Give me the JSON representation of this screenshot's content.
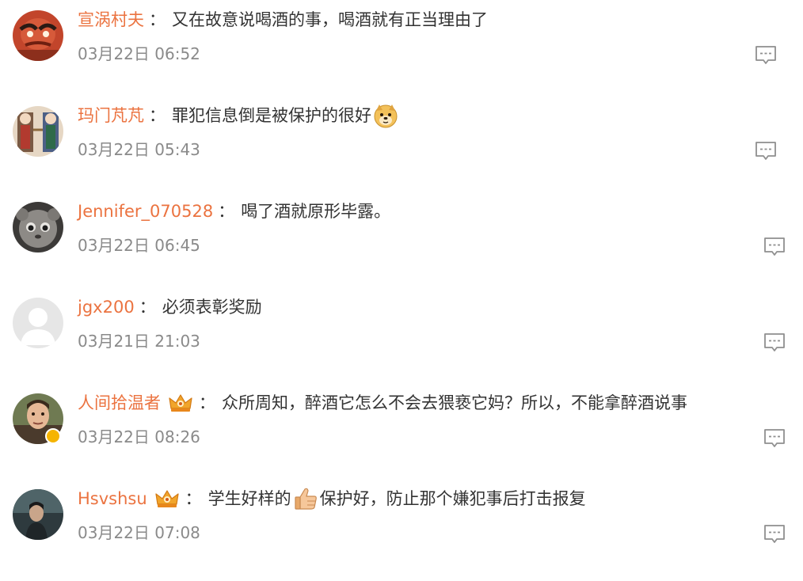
{
  "comments": [
    {
      "username": "宣涡村夫",
      "text": "又在故意说喝酒的事，喝酒就有正当理由了",
      "timestamp": "03月22日 06:52"
    },
    {
      "username": "玛门芃芃",
      "text": "罪犯信息倒是被保护的很好",
      "timestamp": "03月22日 05:43"
    },
    {
      "username": "Jennifer_070528",
      "text": "喝了酒就原形毕露。",
      "timestamp": "03月22日 06:45"
    },
    {
      "username": "jgx200",
      "text": "必须表彰奖励",
      "timestamp": "03月21日 21:03"
    },
    {
      "username": "人间拾温者",
      "text": "众所周知，醉酒它怎么不会去猥亵它妈？所以，不能拿醉酒说事",
      "timestamp": "03月22日 08:26"
    },
    {
      "username": "Hsvshsu",
      "text_before": "学生好样的",
      "text_after": "保护好，防止那个嫌犯事后打击报复",
      "timestamp": "03月22日 07:08"
    }
  ],
  "separator": "：",
  "colors": {
    "username": "#eb7340",
    "text": "#333333",
    "timestamp": "#8a8a8a",
    "verified_badge": "#f5b400"
  }
}
